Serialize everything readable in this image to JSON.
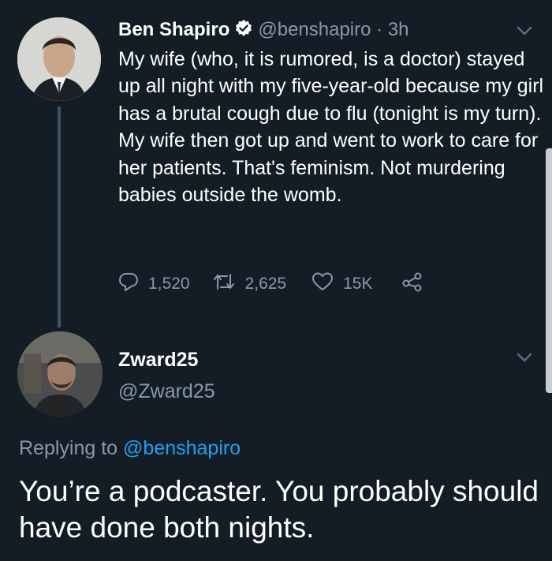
{
  "tweet": {
    "author_name": "Ben Shapiro",
    "author_handle": "@benshapiro",
    "separator": "·",
    "time": "3h",
    "text": "My wife (who, it is rumored, is a doctor) stayed up all night with my five-year-old because my girl has a brutal cough due to flu (tonight is my turn). My wife then got up and went to work to care for her patients. That's feminism. Not murdering babies outside the womb.",
    "reply_count": "1,520",
    "retweet_count": "2,625",
    "like_count": "15K",
    "icons": [
      "verified-badge-icon",
      "chevron-down-icon",
      "reply-icon",
      "retweet-icon",
      "heart-icon",
      "share-icon"
    ]
  },
  "reply": {
    "author_name": "Zward25",
    "author_handle": "@Zward25",
    "replying_prefix": "Replying to",
    "replying_to": "@benshapiro",
    "text": "You’re a podcaster. You probably should have done both nights."
  },
  "colors": {
    "background": "#141d26",
    "text": "#ffffff",
    "muted": "#8899a6",
    "link": "#1da1f2",
    "thread_line": "#3d5466"
  }
}
